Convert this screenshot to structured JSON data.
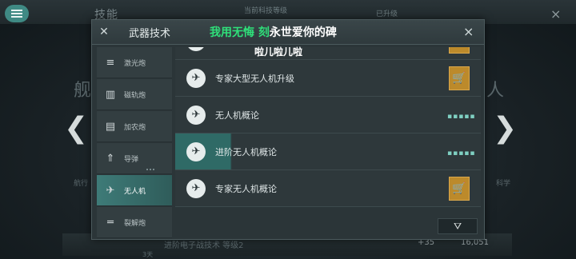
{
  "background": {
    "top_tab_label": "技能",
    "top_center_text": "当前科技等级",
    "top_right_text": "已升级",
    "left_side_text": "舰",
    "right_side_text": "人",
    "left_small_text": "航行",
    "right_small_text": "科学",
    "bottom_text": "进阶电子战技术 等级2",
    "bottom_small": "3天",
    "bottom_num_1": "+35",
    "bottom_num_2": "16,051",
    "nav_left": "❮",
    "nav_right": "❯",
    "menu_icon": "hamburger-menu-icon",
    "close_icon": "×"
  },
  "dialog": {
    "title": "武器技术",
    "close": "×",
    "header_icon": "crossed-weapons-icon"
  },
  "tabs": [
    {
      "label": "激光炮",
      "icon": "≡"
    },
    {
      "label": "磁轨炮",
      "icon": "▥"
    },
    {
      "label": "加农炮",
      "icon": "▤"
    },
    {
      "label": "导弹",
      "icon": "⇑"
    },
    {
      "label": "无人机",
      "icon": "✈"
    },
    {
      "label": "裂解炮",
      "icon": "═"
    }
  ],
  "rows": [
    {
      "label": "",
      "action": "cart"
    },
    {
      "label": "专家大型无人机升级",
      "action": "cart"
    },
    {
      "label": "无人机概论",
      "action": "progress",
      "progress": "▪▪▪▪▪"
    },
    {
      "label": "进阶无人机概论",
      "action": "progress",
      "progress": "▪▪▪▪▪"
    },
    {
      "label": "专家无人机概论",
      "action": "cart"
    }
  ],
  "filter_icon": "filter-icon",
  "cart_glyph": "🛒",
  "drone_glyph": "✈",
  "overlay": {
    "line1_green": "我用无悔 刻",
    "line1_white": "永世爱你的碑",
    "line2": "啦儿啦儿啦"
  }
}
